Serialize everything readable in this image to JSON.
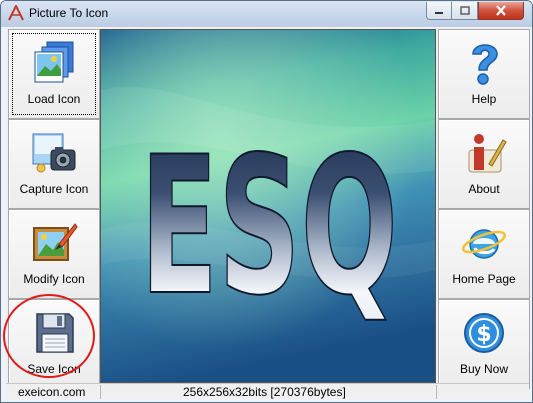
{
  "window": {
    "title": "Picture To Icon"
  },
  "left_buttons": [
    {
      "label": "Load Icon",
      "icon": "load-icon"
    },
    {
      "label": "Capture Icon",
      "icon": "camera-icon"
    },
    {
      "label": "Modify Icon",
      "icon": "paint-icon"
    },
    {
      "label": "Save Icon",
      "icon": "floppy-disk-icon"
    }
  ],
  "right_buttons": [
    {
      "label": "Help",
      "icon": "question-mark-icon"
    },
    {
      "label": "About",
      "icon": "info-icon"
    },
    {
      "label": "Home Page",
      "icon": "internet-explorer-icon"
    },
    {
      "label": "Buy Now",
      "icon": "dollar-icon"
    }
  ],
  "preview": {
    "image_text": "ESQ"
  },
  "status": {
    "website": "exeicon.com",
    "image_info": "256x256x32bits  [270376bytes]"
  },
  "colors": {
    "annotation_circle": "#e01b1b",
    "close_button": "#c2311c"
  }
}
